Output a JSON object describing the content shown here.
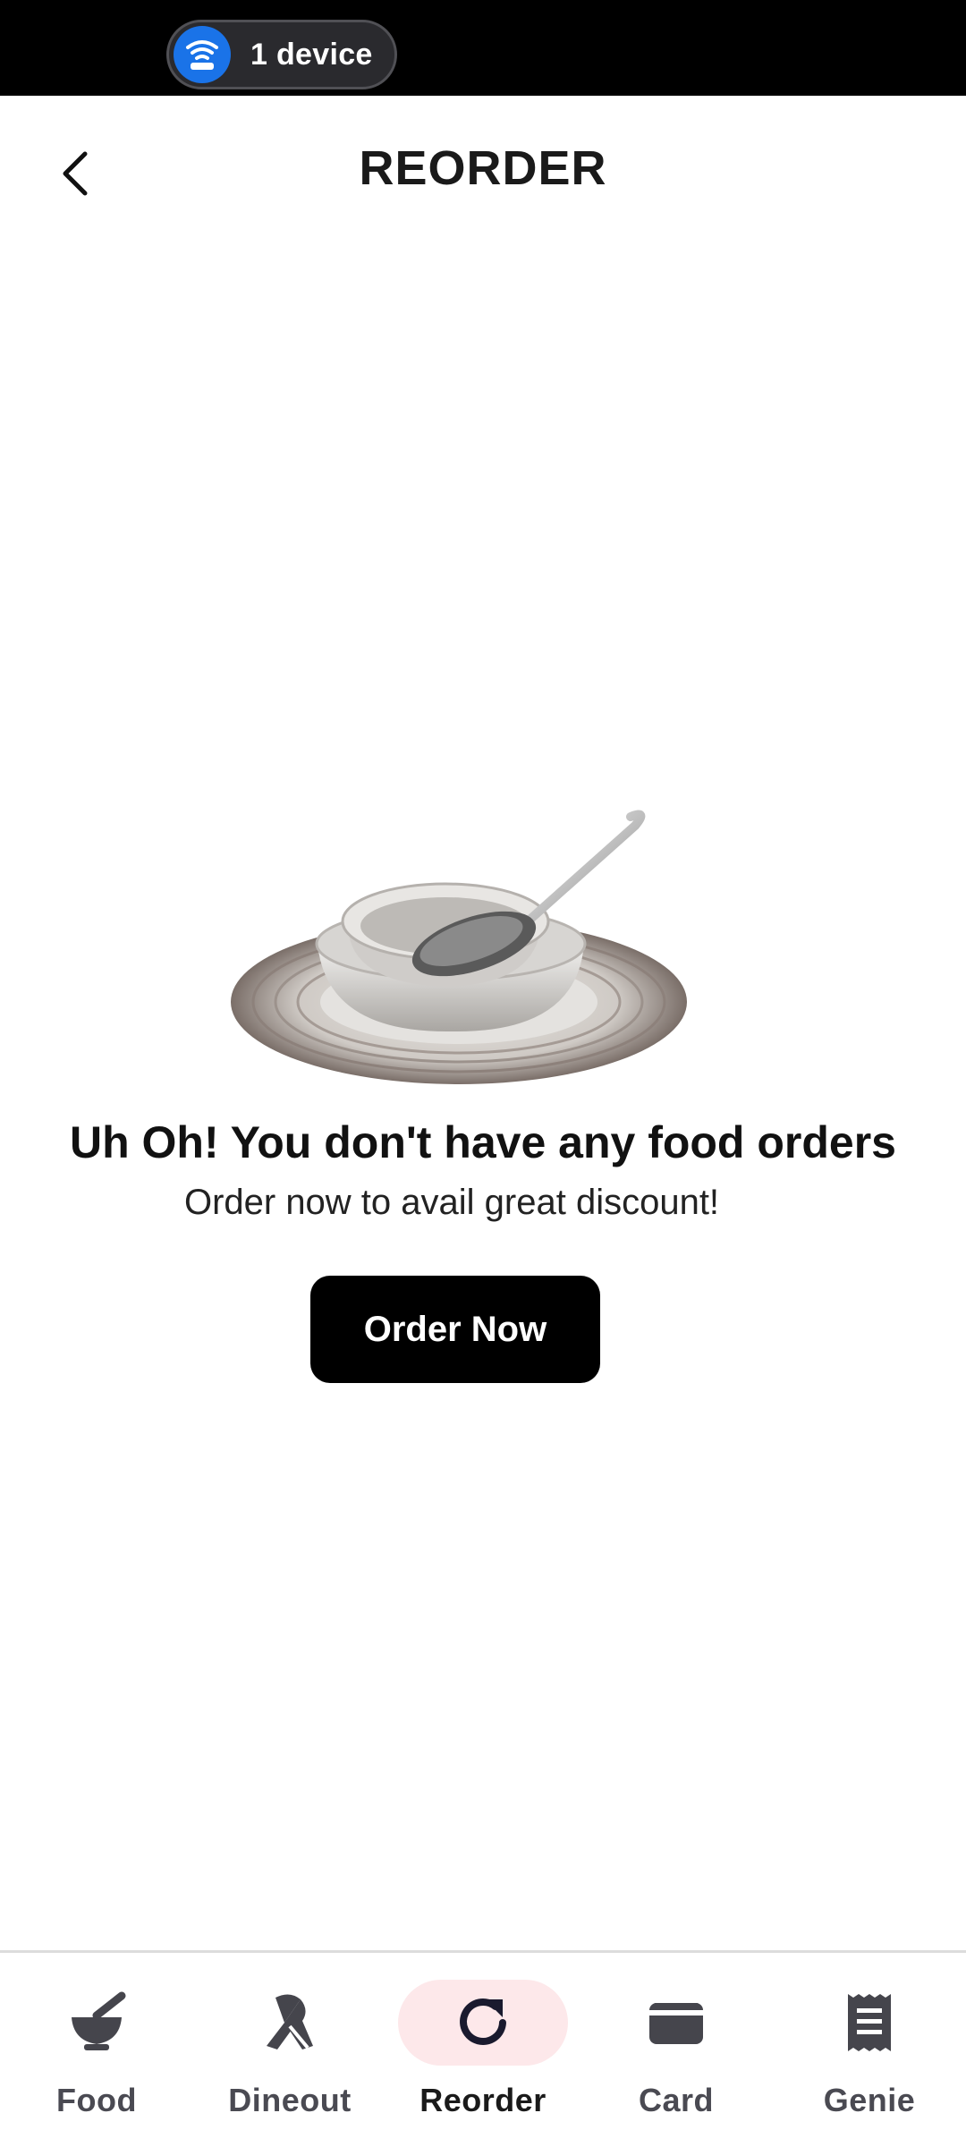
{
  "status_bar": {
    "device_label": "1 device"
  },
  "header": {
    "title": "REORDER"
  },
  "empty_state": {
    "title": "Uh Oh! You don't have any food orders",
    "subtitle": "Order now to avail great discount!",
    "button_label": "Order Now"
  },
  "bottom_nav": {
    "items": [
      {
        "label": "Food",
        "icon": "food-bowl-icon",
        "active": false
      },
      {
        "label": "Dineout",
        "icon": "dineout-icon",
        "active": false
      },
      {
        "label": "Reorder",
        "icon": "reorder-icon",
        "active": true
      },
      {
        "label": "Card",
        "icon": "wallet-card-icon",
        "active": false
      },
      {
        "label": "Genie",
        "icon": "receipt-icon",
        "active": false
      }
    ]
  },
  "colors": {
    "active_tab_bg": "#fde8ea",
    "button_bg": "#000000",
    "wifi_badge": "#1a73e8"
  }
}
